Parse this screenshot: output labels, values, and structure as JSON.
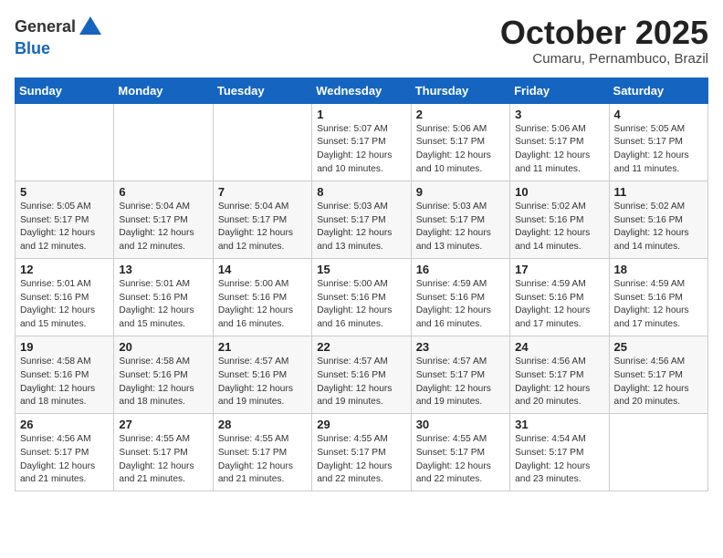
{
  "header": {
    "logo_line1": "General",
    "logo_line2": "Blue",
    "month": "October 2025",
    "location": "Cumaru, Pernambuco, Brazil"
  },
  "weekdays": [
    "Sunday",
    "Monday",
    "Tuesday",
    "Wednesday",
    "Thursday",
    "Friday",
    "Saturday"
  ],
  "weeks": [
    [
      {
        "day": "",
        "info": ""
      },
      {
        "day": "",
        "info": ""
      },
      {
        "day": "",
        "info": ""
      },
      {
        "day": "1",
        "info": "Sunrise: 5:07 AM\nSunset: 5:17 PM\nDaylight: 12 hours\nand 10 minutes."
      },
      {
        "day": "2",
        "info": "Sunrise: 5:06 AM\nSunset: 5:17 PM\nDaylight: 12 hours\nand 10 minutes."
      },
      {
        "day": "3",
        "info": "Sunrise: 5:06 AM\nSunset: 5:17 PM\nDaylight: 12 hours\nand 11 minutes."
      },
      {
        "day": "4",
        "info": "Sunrise: 5:05 AM\nSunset: 5:17 PM\nDaylight: 12 hours\nand 11 minutes."
      }
    ],
    [
      {
        "day": "5",
        "info": "Sunrise: 5:05 AM\nSunset: 5:17 PM\nDaylight: 12 hours\nand 12 minutes."
      },
      {
        "day": "6",
        "info": "Sunrise: 5:04 AM\nSunset: 5:17 PM\nDaylight: 12 hours\nand 12 minutes."
      },
      {
        "day": "7",
        "info": "Sunrise: 5:04 AM\nSunset: 5:17 PM\nDaylight: 12 hours\nand 12 minutes."
      },
      {
        "day": "8",
        "info": "Sunrise: 5:03 AM\nSunset: 5:17 PM\nDaylight: 12 hours\nand 13 minutes."
      },
      {
        "day": "9",
        "info": "Sunrise: 5:03 AM\nSunset: 5:17 PM\nDaylight: 12 hours\nand 13 minutes."
      },
      {
        "day": "10",
        "info": "Sunrise: 5:02 AM\nSunset: 5:16 PM\nDaylight: 12 hours\nand 14 minutes."
      },
      {
        "day": "11",
        "info": "Sunrise: 5:02 AM\nSunset: 5:16 PM\nDaylight: 12 hours\nand 14 minutes."
      }
    ],
    [
      {
        "day": "12",
        "info": "Sunrise: 5:01 AM\nSunset: 5:16 PM\nDaylight: 12 hours\nand 15 minutes."
      },
      {
        "day": "13",
        "info": "Sunrise: 5:01 AM\nSunset: 5:16 PM\nDaylight: 12 hours\nand 15 minutes."
      },
      {
        "day": "14",
        "info": "Sunrise: 5:00 AM\nSunset: 5:16 PM\nDaylight: 12 hours\nand 16 minutes."
      },
      {
        "day": "15",
        "info": "Sunrise: 5:00 AM\nSunset: 5:16 PM\nDaylight: 12 hours\nand 16 minutes."
      },
      {
        "day": "16",
        "info": "Sunrise: 4:59 AM\nSunset: 5:16 PM\nDaylight: 12 hours\nand 16 minutes."
      },
      {
        "day": "17",
        "info": "Sunrise: 4:59 AM\nSunset: 5:16 PM\nDaylight: 12 hours\nand 17 minutes."
      },
      {
        "day": "18",
        "info": "Sunrise: 4:59 AM\nSunset: 5:16 PM\nDaylight: 12 hours\nand 17 minutes."
      }
    ],
    [
      {
        "day": "19",
        "info": "Sunrise: 4:58 AM\nSunset: 5:16 PM\nDaylight: 12 hours\nand 18 minutes."
      },
      {
        "day": "20",
        "info": "Sunrise: 4:58 AM\nSunset: 5:16 PM\nDaylight: 12 hours\nand 18 minutes."
      },
      {
        "day": "21",
        "info": "Sunrise: 4:57 AM\nSunset: 5:16 PM\nDaylight: 12 hours\nand 19 minutes."
      },
      {
        "day": "22",
        "info": "Sunrise: 4:57 AM\nSunset: 5:16 PM\nDaylight: 12 hours\nand 19 minutes."
      },
      {
        "day": "23",
        "info": "Sunrise: 4:57 AM\nSunset: 5:17 PM\nDaylight: 12 hours\nand 19 minutes."
      },
      {
        "day": "24",
        "info": "Sunrise: 4:56 AM\nSunset: 5:17 PM\nDaylight: 12 hours\nand 20 minutes."
      },
      {
        "day": "25",
        "info": "Sunrise: 4:56 AM\nSunset: 5:17 PM\nDaylight: 12 hours\nand 20 minutes."
      }
    ],
    [
      {
        "day": "26",
        "info": "Sunrise: 4:56 AM\nSunset: 5:17 PM\nDaylight: 12 hours\nand 21 minutes."
      },
      {
        "day": "27",
        "info": "Sunrise: 4:55 AM\nSunset: 5:17 PM\nDaylight: 12 hours\nand 21 minutes."
      },
      {
        "day": "28",
        "info": "Sunrise: 4:55 AM\nSunset: 5:17 PM\nDaylight: 12 hours\nand 21 minutes."
      },
      {
        "day": "29",
        "info": "Sunrise: 4:55 AM\nSunset: 5:17 PM\nDaylight: 12 hours\nand 22 minutes."
      },
      {
        "day": "30",
        "info": "Sunrise: 4:55 AM\nSunset: 5:17 PM\nDaylight: 12 hours\nand 22 minutes."
      },
      {
        "day": "31",
        "info": "Sunrise: 4:54 AM\nSunset: 5:17 PM\nDaylight: 12 hours\nand 23 minutes."
      },
      {
        "day": "",
        "info": ""
      }
    ]
  ]
}
